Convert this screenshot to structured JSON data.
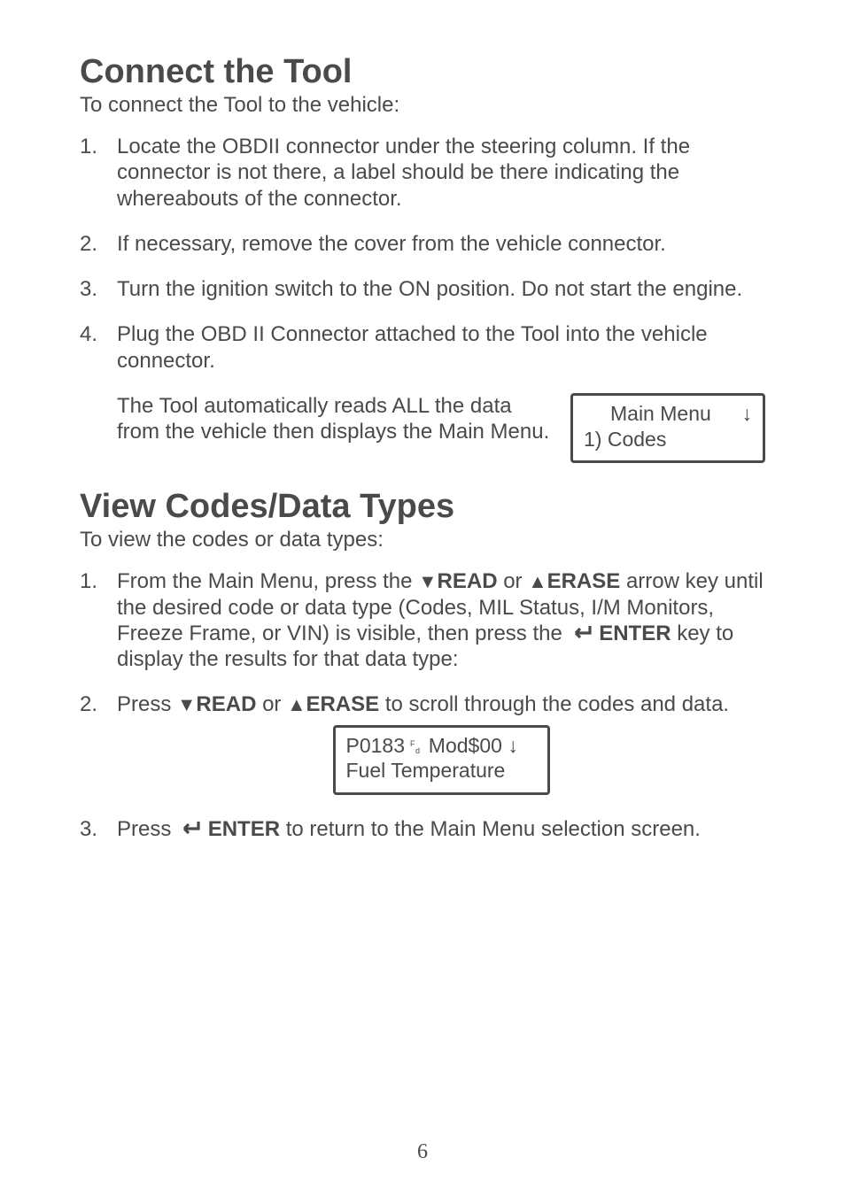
{
  "section1": {
    "heading": "Connect the Tool",
    "subhead": "To connect the Tool to the vehicle:",
    "items": [
      "Locate the OBDII connector under the steering column. If the connector is not there, a label should be there indicating the whereabouts of the connector.",
      "If necessary, remove the cover from the vehicle connector.",
      "Turn the ignition switch to the ON position. Do not start the engine.",
      "Plug the OBD II Connector attached to the Tool into the vehicle connector."
    ],
    "after_item4": "The Tool automatically reads ALL the data from the vehicle then displays the Main Menu.",
    "lcd": {
      "title": "Main Menu",
      "arrow": "↓",
      "line2": "1) Codes"
    }
  },
  "section2": {
    "heading": "View Codes/Data Types",
    "subhead": "To view the codes or data types:",
    "item1_pre": "From the Main Menu, press the ",
    "read_label": "READ",
    "or_label": " or ",
    "erase_label": "ERASE",
    "item1_mid": " arrow key until the desired code or data type (Codes, MIL Status, I/M Monitors, Freeze Frame, or VIN) is visible, then press the ",
    "enter_label": "ENTER",
    "item1_post": " key to display the results for that data type:",
    "item2_pre": "Press ",
    "item2_post": " to scroll through the codes and data.",
    "lcd": {
      "code": "P0183",
      "mod": " Mod$00 ",
      "arrow": "↓",
      "line2": "Fuel Temperature"
    },
    "item3_pre": "Press ",
    "item3_post": " to return to the Main Menu selection screen."
  },
  "page_number": "6"
}
